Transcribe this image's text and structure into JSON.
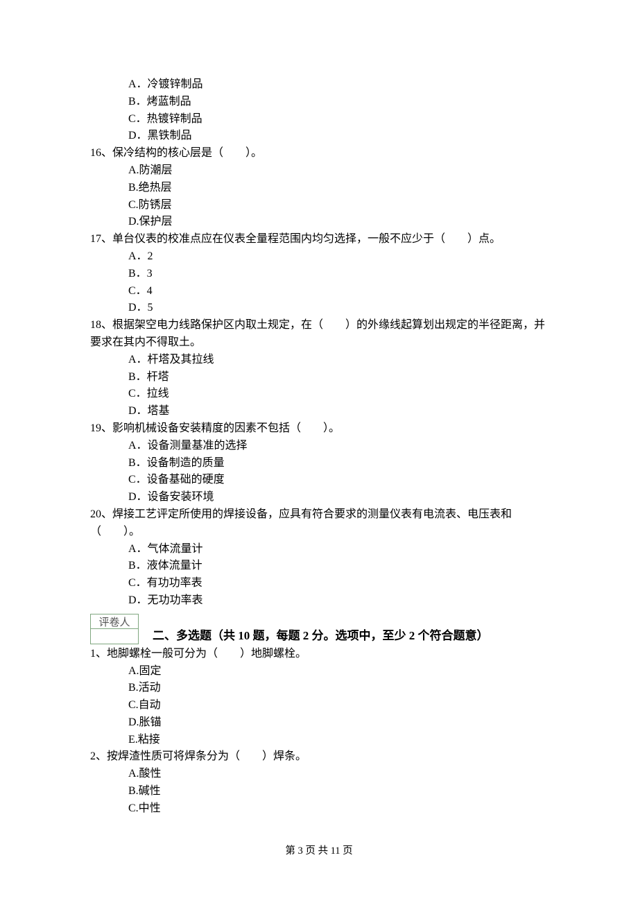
{
  "q15": {
    "A": "A．冷镀锌制品",
    "B": "B．烤蓝制品",
    "C": "C．热镀锌制品",
    "D": "D．黑铁制品"
  },
  "q16": {
    "text": "16、保冷结构的核心层是（　　）。",
    "A": "A.防潮层",
    "B": "B.绝热层",
    "C": "C.防锈层",
    "D": "D.保护层"
  },
  "q17": {
    "text": "17、单台仪表的校准点应在仪表全量程范围内均匀选择，一般不应少于（　　）点。",
    "A": "A．2",
    "B": "B．3",
    "C": "C．4",
    "D": "D．5"
  },
  "q18": {
    "text": "18、根据架空电力线路保护区内取土规定，在（　　）的外缘线起算划出规定的半径距离，并要求在其内不得取土。",
    "A": "A．杆塔及其拉线",
    "B": "B．杆塔",
    "C": "C．拉线",
    "D": "D．塔基"
  },
  "q19": {
    "text": "19、影响机械设备安装精度的因素不包括（　　）。",
    "A": "A．设备测量基准的选择",
    "B": "B．设备制造的质量",
    "C": "C．设备基础的硬度",
    "D": "D．设备安装环境"
  },
  "q20": {
    "text": "20、焊接工艺评定所使用的焊接设备，应具有符合要求的测量仪表有电流表、电压表和（　　）。",
    "A": "A．气体流量计",
    "B": "B．液体流量计",
    "C": "C．有功功率表",
    "D": "D．无功功率表"
  },
  "grader_label": "评卷人",
  "section2_title": "二、多选题（共 10 题，每题 2 分。选项中，至少 2 个符合题意）",
  "m1": {
    "text": "1、地脚螺栓一般可分为（　　）地脚螺栓。",
    "A": "A.固定",
    "B": "B.活动",
    "C": "C.自动",
    "D": "D.胀锚",
    "E": "E.粘接"
  },
  "m2": {
    "text": "2、按焊渣性质可将焊条分为（　　）焊条。",
    "A": "A.酸性",
    "B": "B.碱性",
    "C": "C.中性"
  },
  "footer": "第 3 页 共 11 页"
}
